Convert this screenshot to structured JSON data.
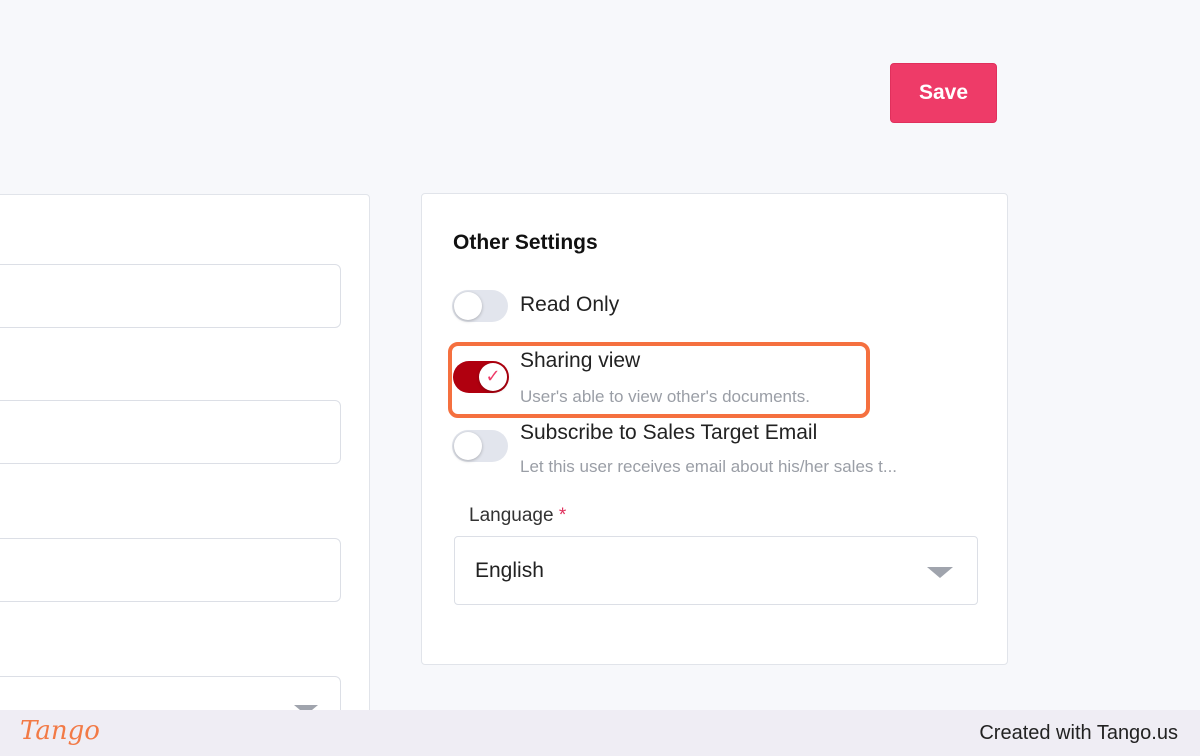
{
  "header": {
    "save_label": "Save"
  },
  "other_settings": {
    "title": "Other Settings",
    "options": [
      {
        "label": "Read Only",
        "description": "",
        "enabled": false
      },
      {
        "label": "Sharing view",
        "description": "User's able to view other's documents.",
        "enabled": true
      },
      {
        "label": "Subscribe to Sales Target Email",
        "description": "Let this user receives email about his/her sales t...",
        "enabled": false
      }
    ],
    "language": {
      "label": "Language",
      "required_mark": "*",
      "value": "English"
    }
  },
  "footer": {
    "logo_text": "Tango",
    "credit": "Created with Tango.us"
  },
  "colors": {
    "accent": "#ee3b68",
    "toggle_on": "#b0000f",
    "highlight": "#f5703f"
  }
}
